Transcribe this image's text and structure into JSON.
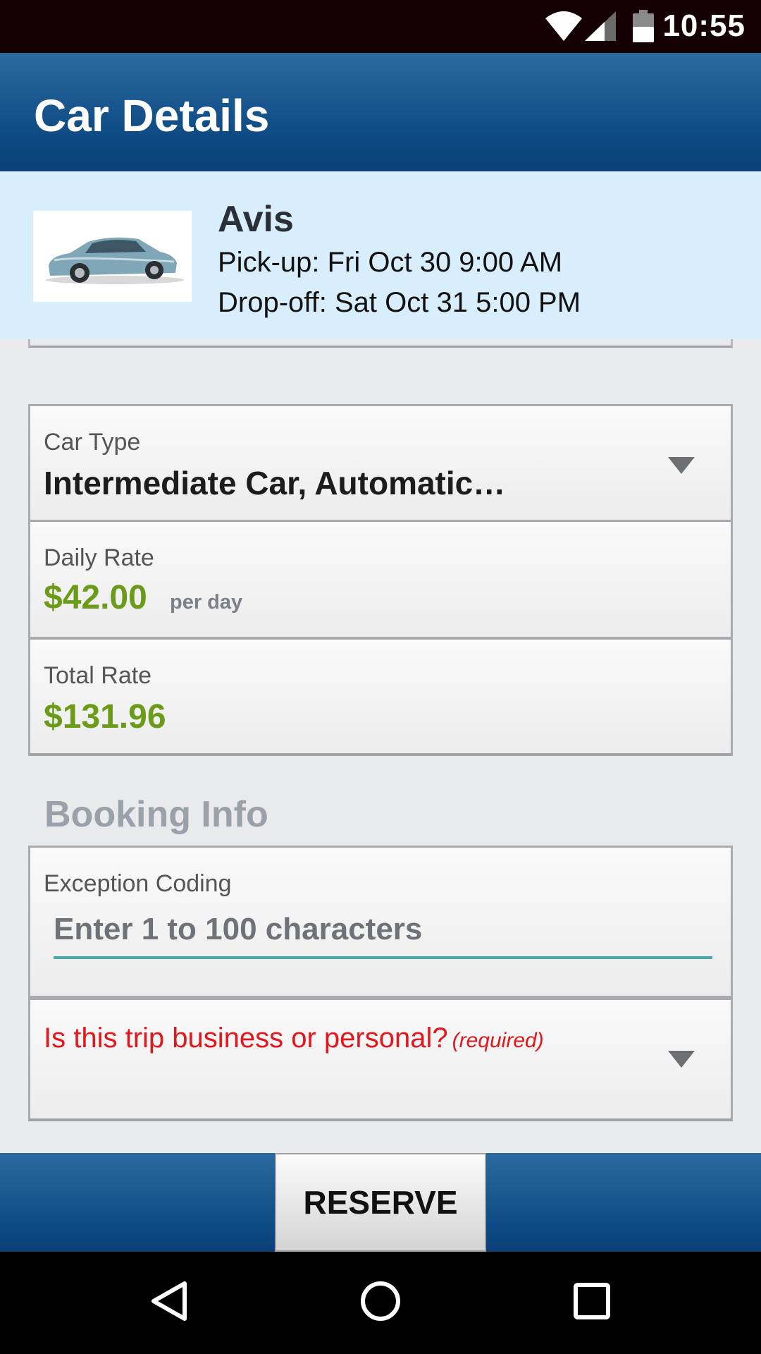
{
  "status_bar": {
    "time": "10:55"
  },
  "app_bar": {
    "title": "Car Details"
  },
  "vendor": {
    "name": "Avis",
    "pickup": "Pick-up: Fri Oct 30 9:00 AM",
    "dropoff": "Drop-off: Sat Oct 31 5:00 PM"
  },
  "car_type": {
    "label": "Car Type",
    "value": "Intermediate Car, Automatic…"
  },
  "daily_rate": {
    "label": "Daily Rate",
    "value": "$42.00",
    "unit": "per day"
  },
  "total_rate": {
    "label": "Total Rate",
    "value": "$131.96"
  },
  "booking_info": {
    "title": "Booking Info",
    "exception_label": "Exception Coding",
    "exception_placeholder": "Enter 1 to 100 characters",
    "exception_value": "",
    "trip_question": "Is this trip business or personal?",
    "trip_required": "(required)"
  },
  "actions": {
    "reserve_label": "RESERVE"
  },
  "colors": {
    "accent_price": "#6c9b1a",
    "required_red": "#e2161b",
    "brand_blue": "#0e4a83"
  }
}
